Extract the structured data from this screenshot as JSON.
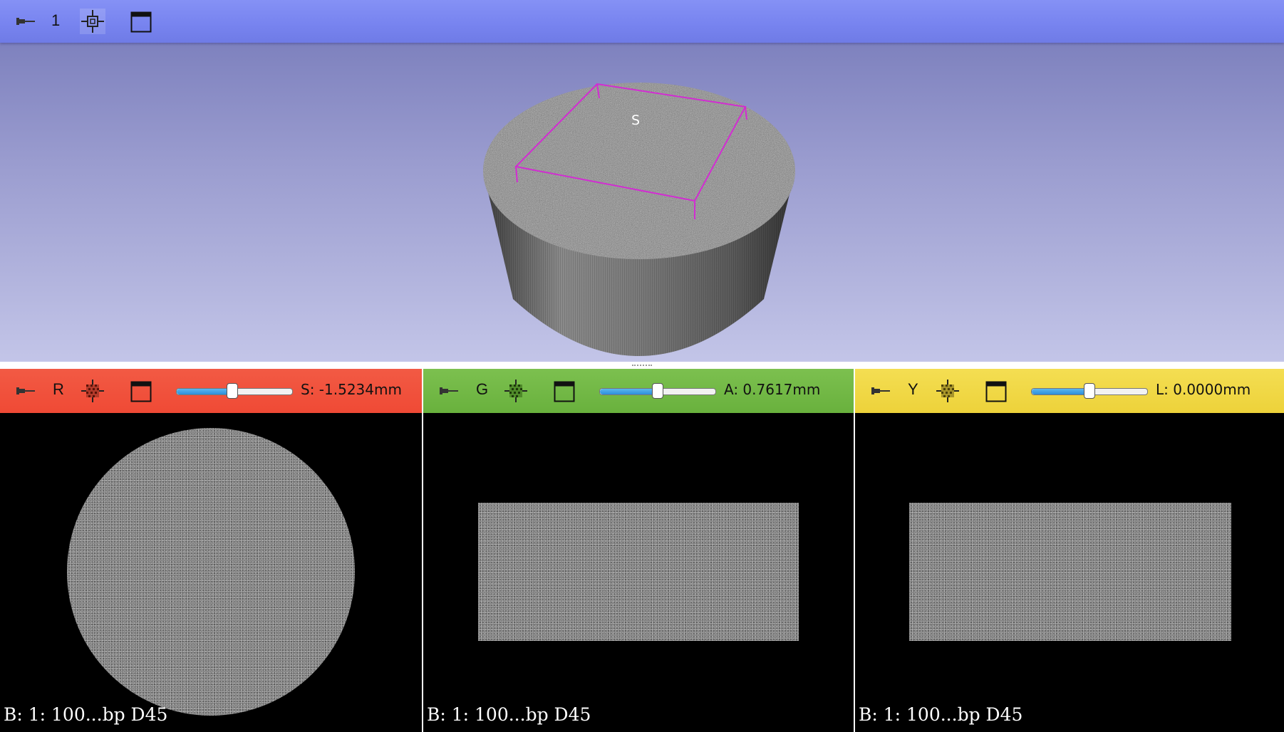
{
  "view3d": {
    "view_number": "1",
    "orientation_label": "S",
    "colors": {
      "bar": "#7783ef",
      "background_top": "#7478b8",
      "background_bottom": "#c3c5e8",
      "roi": "#d22cd2"
    },
    "icons": [
      "pin-icon",
      "center-view-icon",
      "maximize-view-icon"
    ]
  },
  "slices": [
    {
      "id": "red",
      "letter": "R",
      "color": "#ef4a35",
      "offset_text": "S: -1.5234mm",
      "slider_fraction": 0.48,
      "footer": "B: 1: 100...bp D45",
      "content_shape": "circle"
    },
    {
      "id": "green",
      "letter": "G",
      "color": "#69b13d",
      "offset_text": "A: 0.7617mm",
      "slider_fraction": 0.5,
      "footer": "B: 1: 100...bp D45",
      "content_shape": "rectangle"
    },
    {
      "id": "yellow",
      "letter": "Y",
      "color": "#edd23a",
      "offset_text": "L: 0.0000mm",
      "slider_fraction": 0.5,
      "footer": "B: 1: 100...bp D45",
      "content_shape": "rectangle"
    }
  ]
}
